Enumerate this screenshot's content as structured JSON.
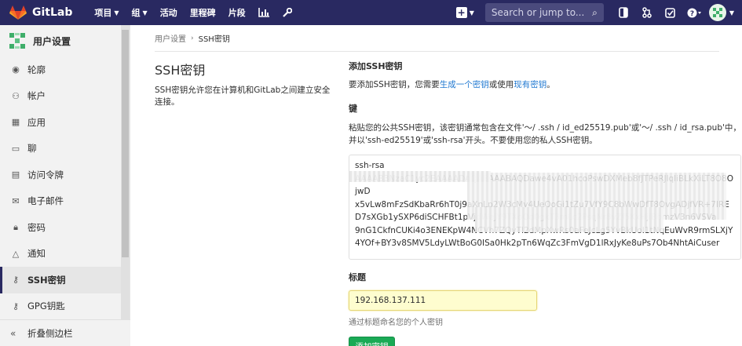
{
  "navbar": {
    "brand": "GitLab",
    "items": [
      {
        "label": "项目",
        "dropdown": true
      },
      {
        "label": "组",
        "dropdown": true
      },
      {
        "label": "活动",
        "dropdown": false
      },
      {
        "label": "里程碑",
        "dropdown": false
      },
      {
        "label": "片段",
        "dropdown": false
      }
    ],
    "search_placeholder": "Search or jump to..."
  },
  "sidebar": {
    "title": "用户设置",
    "items": [
      {
        "label": "轮廓",
        "icon": "profile-icon"
      },
      {
        "label": "帐户",
        "icon": "account-icon"
      },
      {
        "label": "应用",
        "icon": "applications-icon"
      },
      {
        "label": "聊",
        "icon": "chat-icon"
      },
      {
        "label": "访问令牌",
        "icon": "token-icon"
      },
      {
        "label": "电子邮件",
        "icon": "email-icon"
      },
      {
        "label": "密码",
        "icon": "lock-icon"
      },
      {
        "label": "通知",
        "icon": "bell-icon"
      },
      {
        "label": "SSH密钥",
        "icon": "key-icon",
        "active": true
      },
      {
        "label": "GPG钥匙",
        "icon": "key-icon"
      }
    ],
    "collapse_label": "折叠侧边栏"
  },
  "breadcrumb": {
    "parent": "用户设置",
    "current": "SSH密钥"
  },
  "intro": {
    "title": "SSH密钥",
    "description": "SSH密钥允许您在计算机和GitLab之间建立安全连接。"
  },
  "form": {
    "add_title": "添加SSH密钥",
    "add_text_prefix": "要添加SSH密钥，您需要",
    "add_link_generate": "生成一个密钥",
    "add_text_mid": "或使用",
    "add_link_existing": "现有密钥",
    "add_text_suffix": "。",
    "key_label": "键",
    "key_help": "粘贴您的公共SSH密钥，该密钥通常包含在文件'〜/ .ssh / id_ed25519.pub'或'〜/ .ssh / id_rsa.pub'中，并以'ssh-ed25519'或'ssh-rsa'开头。不要使用您的私人SSH密钥。",
    "key_value_lines": [
      "ssh-rsa",
      "AAAAB3NzaC1yc2EAAAADAQABAAABAQDawe4vA01hcoPswDXMeb8fJTPeRJlqliBLkXiLT8O8OjwD",
      "x5vLw8mFzSdKbaRr6hT0j9aXnLp2W3cMy4UeQoGi1tZu7VfY9C8bWwDfT8QvgADjfVR+7IRE",
      "D7sXGb1ySXP6diSCHFBt1pVjdWeJY9TXoOd0gkT3mLc2PsqNr8vZf5KxHjiBbmzV3n6VSVa",
      "9nG1CkfnCUKi4o3ENEKpW4NCVh7ZQyTl2dMpXwRs0aFeJcLg5YvBkUoI1tNqEuWvR9rmSLXjY",
      "4YOf+BY3v8SMV5LdyLWtBoG0ISa0Hk2pTn6WqZc3FmVgD1lRxJyKe8uPs7Ob4NhtAiCuser"
    ],
    "title_label": "标题",
    "title_value": "192.168.137.111",
    "title_help": "通过标题命名您的个人密钥",
    "submit_label": "添加密钥"
  },
  "colors": {
    "navbar_bg": "#292961",
    "link": "#1f78d1",
    "submit_bg": "#1aaa55",
    "autofill_bg": "#fefdcf"
  }
}
